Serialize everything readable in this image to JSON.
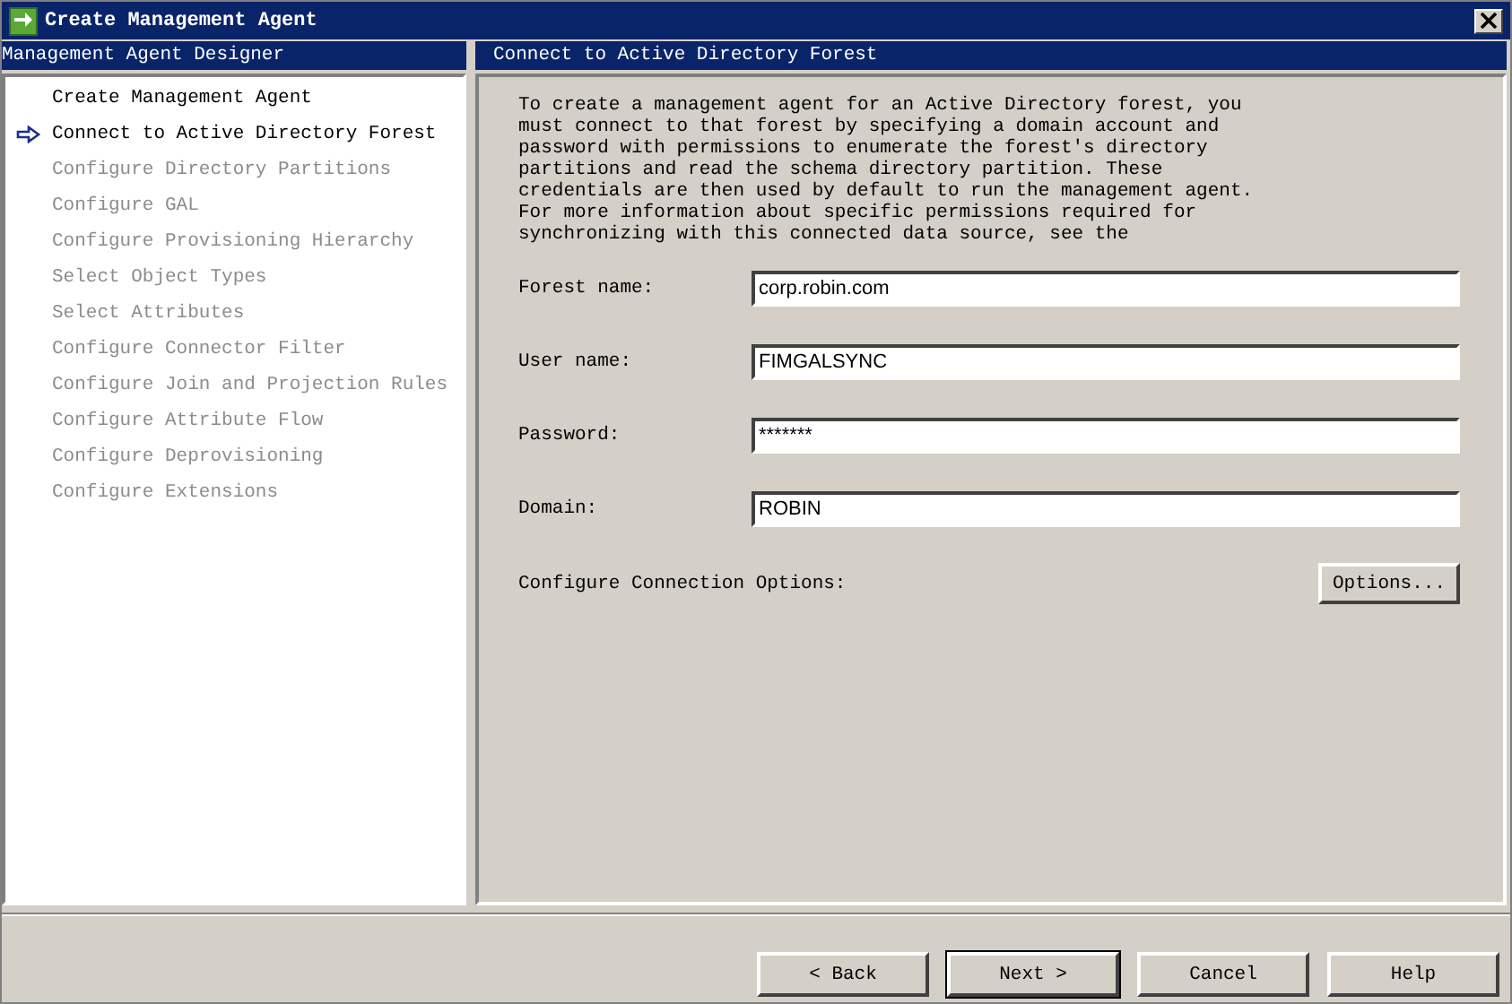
{
  "window": {
    "title": "Create Management Agent"
  },
  "sidebar": {
    "title": "Management Agent Designer",
    "items": [
      {
        "label": "Create Management Agent",
        "current": false,
        "disabled": false
      },
      {
        "label": "Connect to Active Directory Forest",
        "current": true,
        "disabled": false
      },
      {
        "label": "Configure Directory Partitions",
        "current": false,
        "disabled": true
      },
      {
        "label": "Configure GAL",
        "current": false,
        "disabled": true
      },
      {
        "label": "Configure Provisioning Hierarchy",
        "current": false,
        "disabled": true
      },
      {
        "label": "Select Object Types",
        "current": false,
        "disabled": true
      },
      {
        "label": "Select Attributes",
        "current": false,
        "disabled": true
      },
      {
        "label": "Configure Connector Filter",
        "current": false,
        "disabled": true
      },
      {
        "label": "Configure Join and Projection Rules",
        "current": false,
        "disabled": true
      },
      {
        "label": "Configure Attribute Flow",
        "current": false,
        "disabled": true
      },
      {
        "label": "Configure Deprovisioning",
        "current": false,
        "disabled": true
      },
      {
        "label": "Configure Extensions",
        "current": false,
        "disabled": true
      }
    ]
  },
  "page": {
    "title": "Connect to Active Directory Forest",
    "description": "To create a management agent for an Active Directory forest, you\nmust connect to that forest by specifying a domain account and\npassword with permissions to enumerate the forest's directory\npartitions and read the schema directory partition. These\ncredentials are then used by default to run the management agent.\nFor more information about specific permissions required for\nsynchronizing with this connected data source, see the",
    "fields": [
      {
        "label": "Forest name:",
        "value": "corp.robin.com"
      },
      {
        "label": "User name:",
        "value": "FIMGALSYNC"
      },
      {
        "label": "Password:",
        "value": "*******"
      },
      {
        "label": "Domain:",
        "value": "ROBIN"
      }
    ],
    "options_label": "Configure Connection Options:",
    "options_button": "Options..."
  },
  "buttons": [
    {
      "label": "<  Back",
      "default": false
    },
    {
      "label": "Next  >",
      "default": true
    },
    {
      "label": "Cancel",
      "default": false
    },
    {
      "label": "Help",
      "default": false
    }
  ]
}
